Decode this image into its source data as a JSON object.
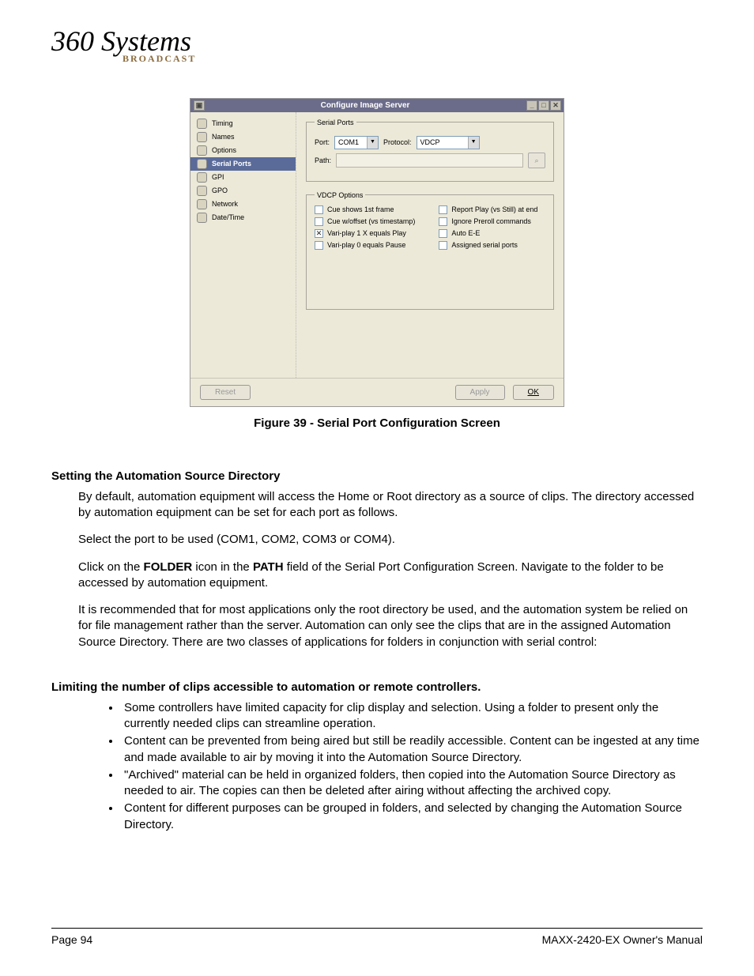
{
  "logo": {
    "main": "360 Systems",
    "sub": "BROADCAST"
  },
  "window": {
    "title": "Configure Image Server",
    "nav": [
      "Timing",
      "Names",
      "Options",
      "Serial Ports",
      "GPI",
      "GPO",
      "Network",
      "Date/Time"
    ],
    "nav_selected_index": 3,
    "serial": {
      "legend": "Serial Ports",
      "port_label": "Port:",
      "port_value": "COM1",
      "protocol_label": "Protocol:",
      "protocol_value": "VDCP",
      "path_label": "Path:",
      "path_value": ""
    },
    "vdcp": {
      "legend": "VDCP Options",
      "left": [
        "Cue shows 1st frame",
        "Cue w/offset (vs timestamp)",
        "Vari-play 1 X equals Play",
        "Vari-play 0 equals Pause"
      ],
      "right": [
        "Report Play (vs Still) at end",
        "Ignore Preroll commands",
        "Auto E-E",
        "Assigned serial ports"
      ],
      "checked_left_index": 2
    },
    "buttons": {
      "reset": "Reset",
      "apply": "Apply",
      "ok": "OK"
    }
  },
  "caption": "Figure 39 - Serial Port Configuration Screen",
  "h1": "Setting the Automation Source Directory",
  "p1": "By default, automation equipment will access the Home or Root directory as a source of clips. The directory accessed by automation equipment can be set for each port as follows.",
  "p2": "Select the port to be used (COM1, COM2, COM3 or COM4).",
  "p3a": "Click on the ",
  "p3b": "FOLDER",
  "p3c": " icon in the ",
  "p3d": "PATH",
  "p3e": " field of the Serial Port Configuration Screen. Navigate to the folder to be accessed by automation equipment.",
  "p4": "It is recommended that for most applications only the root directory be used, and the automation system be relied on for file management rather than the server.  Automation can only see the clips that are in the assigned Automation Source Directory.  There are two classes of applications for folders in conjunction with serial control:",
  "h2": "Limiting the number of clips accessible to automation or remote controllers.",
  "bullets": [
    "Some controllers have limited capacity for clip display and selection. Using a folder to present only the currently needed clips can streamline operation.",
    "Content can be prevented from being aired but still be readily accessible.  Content can be ingested at any time and made available to air by moving it into the Automation Source Directory.",
    " \"Archived\" material can be held in organized folders, then copied into the Automation Source Directory as needed to air. The copies can then be deleted after airing without affecting the archived copy.",
    "Content for different purposes can be grouped in folders, and selected by changing the Automation Source Directory."
  ],
  "footer": {
    "left": "Page 94",
    "right": "MAXX-2420-EX Owner's Manual"
  }
}
